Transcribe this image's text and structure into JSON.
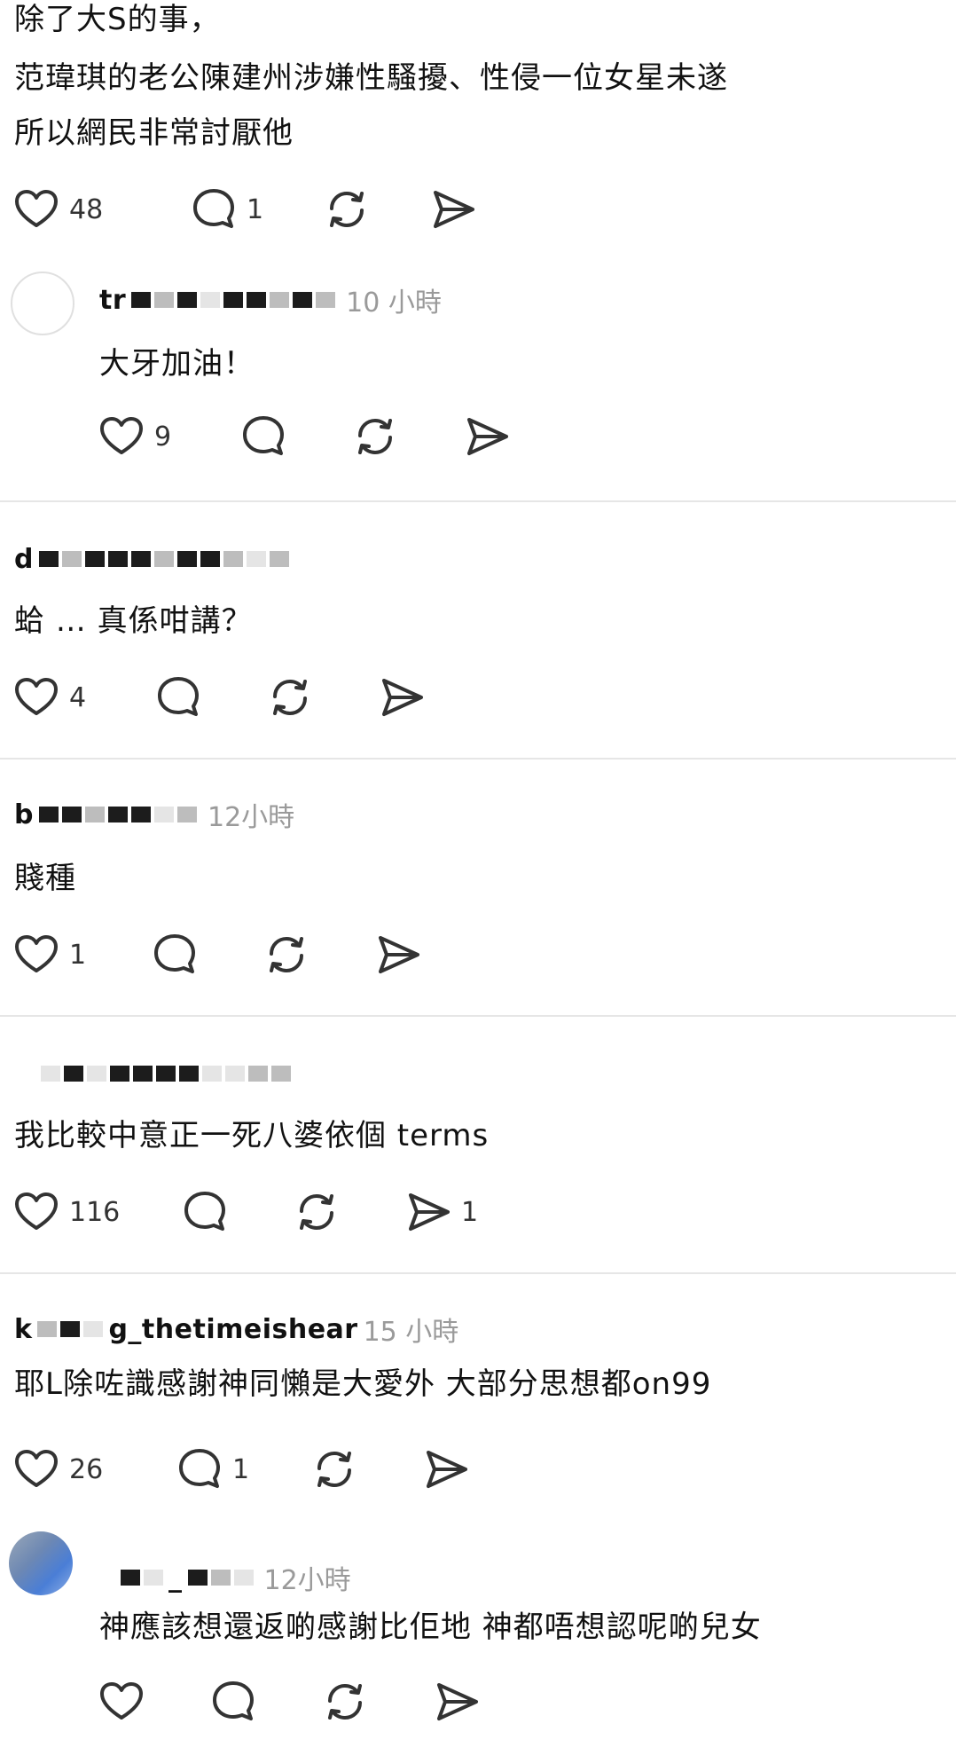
{
  "post_main": {
    "text_lines": [
      "除了大S的事，",
      "范瑋琪的老公陳建州涉嫌性騷擾、性侵一位女星未遂",
      "所以網民非常討厭他"
    ],
    "likes": "48",
    "replies": "1"
  },
  "comments": [
    {
      "username": "tr",
      "time": "10 小時",
      "text": "大牙加油！",
      "likes": "9"
    },
    {
      "username": "d",
      "text": "蛤 … 真係咁講？",
      "likes": "4"
    },
    {
      "username": "b",
      "time": "12小時",
      "text": "賤種",
      "likes": "1"
    },
    {
      "text": "我比較中意正一死八婆依個 terms",
      "likes": "116",
      "shares": "1"
    },
    {
      "username": "k",
      "username_suffix": "g_thetimeishear",
      "time": "15 小時",
      "text": "耶L除咗識感謝神同懶是大愛外 大部分思想都on99",
      "likes": "26",
      "replies": "1"
    },
    {
      "username": "_",
      "time": "12小時",
      "text": "神應該想還返啲感謝比佢地 神都唔想認呢啲兒女"
    }
  ],
  "icons": [
    "heart-icon",
    "comment-icon",
    "repost-icon",
    "share-icon"
  ]
}
